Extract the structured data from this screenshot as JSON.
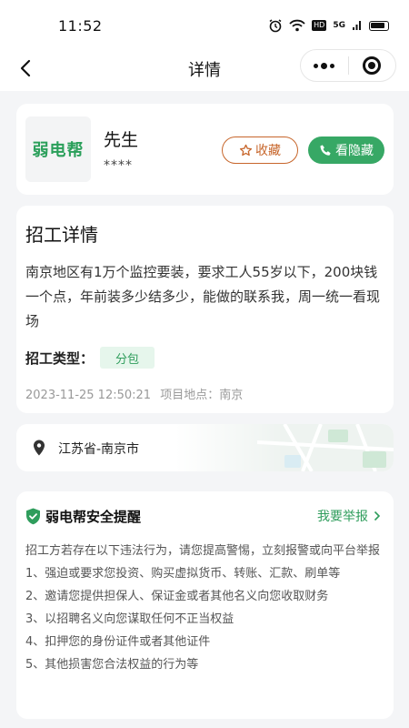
{
  "status_bar": {
    "time": "11:52",
    "signal_label": "5G",
    "hd_label": "HD"
  },
  "nav": {
    "title": "详情"
  },
  "profile": {
    "logo_text": "弱电帮",
    "name": "先生",
    "phone_masked": "****",
    "favorite_label": "收藏",
    "show_hidden_label": "看隐藏"
  },
  "job": {
    "section_title": "招工详情",
    "description": "南京地区有1万个监控要装，要求工人55岁以下，200块钱一个点，年前装多少结多少，能做的联系我，周一统一看现场",
    "type_label": "招工类型：",
    "type_value": "分包",
    "date": "2023-11-25 12:50:21",
    "location_label": "项目地点：",
    "location_value": "南京"
  },
  "location": {
    "address": "江苏省-南京市"
  },
  "safety": {
    "title": "弱电帮安全提醒",
    "report_label": "我要举报",
    "intro": "招工方若存在以下违法行为，请您提高警惕，立刻报警或向平台举报",
    "items": [
      "1、强迫或要求您投资、购买虚拟货币、转账、汇款、刷单等",
      "2、邀请您提供担保人、保证金或者其他名义向您收取财务",
      "3、以招聘名义向您谋取任何不正当权益",
      "4、扣押您的身份证件或者其他证件",
      "5、其他损害您合法权益的行为等"
    ]
  },
  "colors": {
    "brand_green": "#37a865",
    "favorite_orange": "#c7662b",
    "badge_bg": "#e6f6ec"
  }
}
